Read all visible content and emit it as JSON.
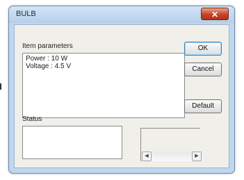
{
  "window": {
    "title": "BULB",
    "close_glyph": "✕"
  },
  "items": {
    "label": "Item parameters",
    "lines": [
      "Power : 10 W",
      "Voltage : 4.5 V"
    ]
  },
  "status": {
    "label": "Status"
  },
  "buttons": {
    "ok": "OK",
    "cancel": "Cancel",
    "default": "Default"
  },
  "scrollbar": {
    "left_glyph": "◀",
    "right_glyph": "▶"
  }
}
